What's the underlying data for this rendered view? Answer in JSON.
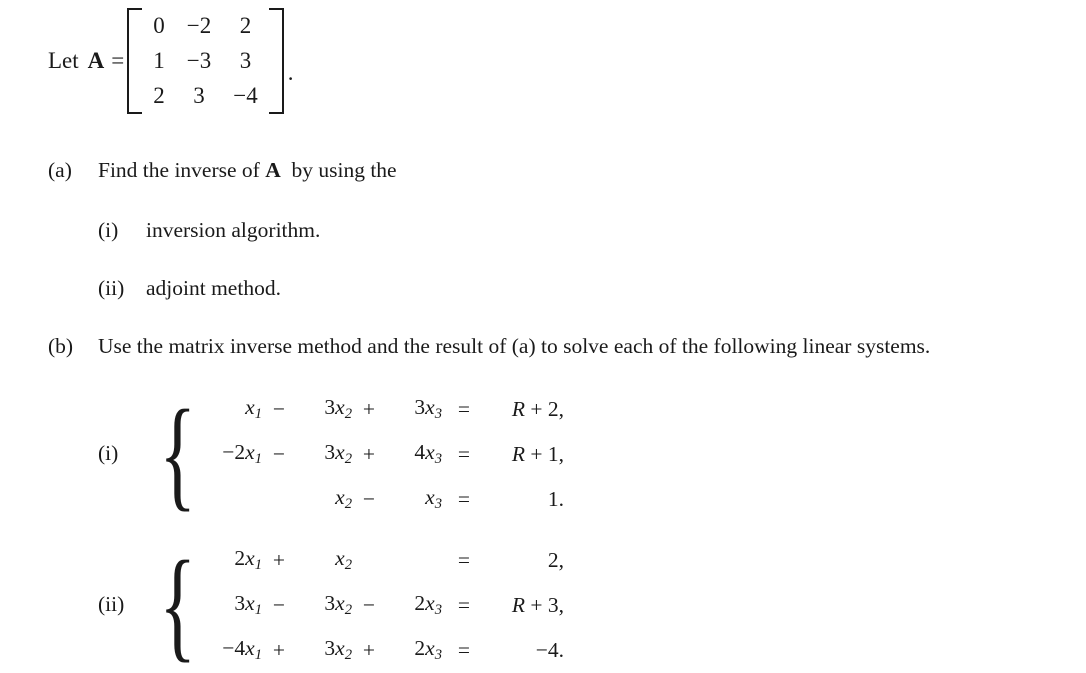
{
  "matrix_line": {
    "let_label": "Let",
    "matrix_name": "A",
    "equals": "=",
    "rows": [
      [
        "0",
        "−2",
        "2"
      ],
      [
        "1",
        "−3",
        "3"
      ],
      [
        "2",
        "3",
        "−4"
      ]
    ],
    "trailing_punctuation": "."
  },
  "parts": {
    "a": {
      "marker": "(a)",
      "text": "Find the inverse of",
      "matrix_name": "A",
      "text_after": "by using the",
      "subparts": [
        {
          "marker": "(i)",
          "text": "inversion algorithm."
        },
        {
          "marker": "(ii)",
          "text": "adjoint method."
        }
      ]
    },
    "b": {
      "marker": "(b)",
      "text": "Use the matrix inverse method and the result of (a) to solve each of the following linear systems."
    }
  },
  "systems": [
    {
      "marker": "(i)",
      "equations": [
        {
          "terms": [
            {
              "coef": "",
              "var": "x",
              "sub": "1"
            },
            {
              "coef": "3",
              "var": "x",
              "sub": "2"
            },
            {
              "coef": "3",
              "var": "x",
              "sub": "3"
            }
          ],
          "ops": [
            "",
            "−",
            "+"
          ],
          "relation": "=",
          "rhs": "R + 2,"
        },
        {
          "terms": [
            {
              "coef": "−2",
              "var": "x",
              "sub": "1"
            },
            {
              "coef": "3",
              "var": "x",
              "sub": "2"
            },
            {
              "coef": "4",
              "var": "x",
              "sub": "3"
            }
          ],
          "ops": [
            "",
            "−",
            "+"
          ],
          "relation": "=",
          "rhs": "R + 1,"
        },
        {
          "terms": [
            {
              "coef": "",
              "var": "",
              "sub": ""
            },
            {
              "coef": "",
              "var": "x",
              "sub": "2"
            },
            {
              "coef": "",
              "var": "x",
              "sub": "3"
            }
          ],
          "ops": [
            "",
            "",
            "−"
          ],
          "relation": "=",
          "rhs": "1."
        }
      ]
    },
    {
      "marker": "(ii)",
      "equations": [
        {
          "terms": [
            {
              "coef": "2",
              "var": "x",
              "sub": "1"
            },
            {
              "coef": "",
              "var": "x",
              "sub": "2"
            },
            {
              "coef": "",
              "var": "",
              "sub": ""
            }
          ],
          "ops": [
            "",
            "+",
            ""
          ],
          "relation": "=",
          "rhs": "2,"
        },
        {
          "terms": [
            {
              "coef": "3",
              "var": "x",
              "sub": "1"
            },
            {
              "coef": "3",
              "var": "x",
              "sub": "2"
            },
            {
              "coef": "2",
              "var": "x",
              "sub": "3"
            }
          ],
          "ops": [
            "",
            "−",
            "−"
          ],
          "relation": "=",
          "rhs": "R + 3,"
        },
        {
          "terms": [
            {
              "coef": "−4",
              "var": "x",
              "sub": "1"
            },
            {
              "coef": "3",
              "var": "x",
              "sub": "2"
            },
            {
              "coef": "2",
              "var": "x",
              "sub": "3"
            }
          ],
          "ops": [
            "",
            "+",
            "+"
          ],
          "relation": "=",
          "rhs": "−4."
        }
      ]
    }
  ],
  "colors": {
    "background": "#ffffff",
    "text": "#1a1a1a"
  }
}
